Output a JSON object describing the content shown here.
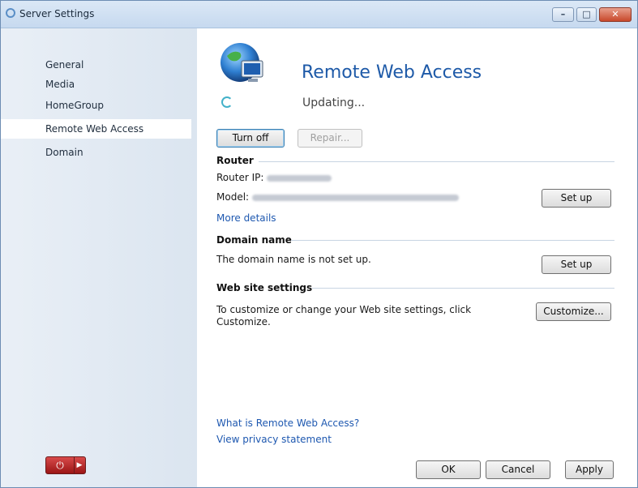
{
  "window": {
    "title": "Server Settings",
    "controls": {
      "minimize": "–",
      "maximize": "□",
      "close": "✕"
    }
  },
  "sidebar": {
    "items": [
      {
        "label": "General",
        "selected": false
      },
      {
        "label": "Media",
        "selected": false
      },
      {
        "label": "HomeGroup",
        "selected": false
      },
      {
        "label": "Remote Web Access",
        "selected": true
      },
      {
        "label": "Domain",
        "selected": false
      }
    ],
    "power_icon": "power-icon",
    "menu_arrow_icon": "triangle-right-icon"
  },
  "main": {
    "title": "Remote Web Access",
    "status": "Updating...",
    "icon": "globe-monitor-icon",
    "buttons": {
      "turn_off": "Turn off",
      "repair": "Repair..."
    },
    "router": {
      "heading": "Router",
      "ip_label": "Router IP:",
      "model_label": "Model:",
      "more_details": "More details",
      "setup_button": "Set up"
    },
    "domain": {
      "heading": "Domain name",
      "text": "The domain name is not set up.",
      "setup_button": "Set up"
    },
    "website": {
      "heading": "Web site settings",
      "text_line1": "To customize or change your Web site settings, click",
      "text_line2": "Customize.",
      "customize_button": "Customize..."
    },
    "links": {
      "what_is": "What is Remote Web Access?",
      "privacy": "View privacy statement"
    }
  },
  "footer": {
    "ok": "OK",
    "cancel": "Cancel",
    "apply": "Apply"
  },
  "colors": {
    "accent": "#1e5aa8",
    "link": "#1e58b0",
    "close_button": "#c8482b",
    "power_button": "#b52020"
  }
}
